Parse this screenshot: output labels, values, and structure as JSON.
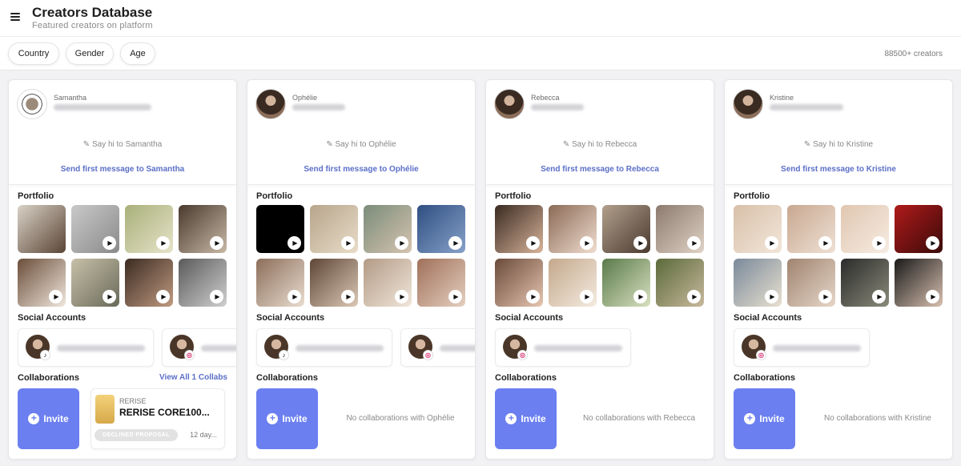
{
  "header": {
    "title": "Creators Database",
    "subtitle": "Featured creators on platform"
  },
  "filters": [
    "Country",
    "Gender",
    "Age"
  ],
  "creators_count": "88500+ creators",
  "labels": {
    "portfolio": "Portfolio",
    "social": "Social Accounts",
    "collaborations": "Collaborations",
    "invite": "Invite"
  },
  "icons": {
    "menu": "hamburger-menu-icon",
    "edit": "pencil-edit-icon",
    "play": "play-icon",
    "instagram": "instagram-icon",
    "tiktok": "tiktok-icon",
    "plus": "plus-circle-icon"
  },
  "colors": {
    "accent": "#6b7ff0",
    "link": "#5b6fc7"
  },
  "cards": [
    {
      "name": "Samantha",
      "say_hi": "Say hi to Samantha",
      "send": "Send first message to Samantha",
      "portfolio_videos": 8,
      "socials": [
        {
          "platform": "tiktok"
        },
        {
          "platform": "instagram"
        }
      ],
      "view_all": "View All 1 Collabs",
      "collab": {
        "brand": "RERISE",
        "name": "RERISE CORE100...",
        "status": "DECLINED PROPOSAL",
        "age": "12 day..."
      }
    },
    {
      "name": "Ophélie",
      "say_hi": "Say hi to Ophélie",
      "send": "Send first message to Ophélie",
      "portfolio_videos": 8,
      "socials": [
        {
          "platform": "tiktok"
        },
        {
          "platform": "instagram"
        }
      ],
      "no_collab": "No collaborations with Ophélie"
    },
    {
      "name": "Rebecca",
      "say_hi": "Say hi to Rebecca",
      "send": "Send first message to Rebecca",
      "portfolio_videos": 8,
      "socials": [
        {
          "platform": "instagram"
        }
      ],
      "no_collab": "No collaborations with Rebecca"
    },
    {
      "name": "Kristine",
      "say_hi": "Say hi to Kristine",
      "send": "Send first message to Kristine",
      "portfolio_videos": 8,
      "socials": [
        {
          "platform": "instagram"
        }
      ],
      "no_collab": "No collaborations with Kristine"
    }
  ]
}
